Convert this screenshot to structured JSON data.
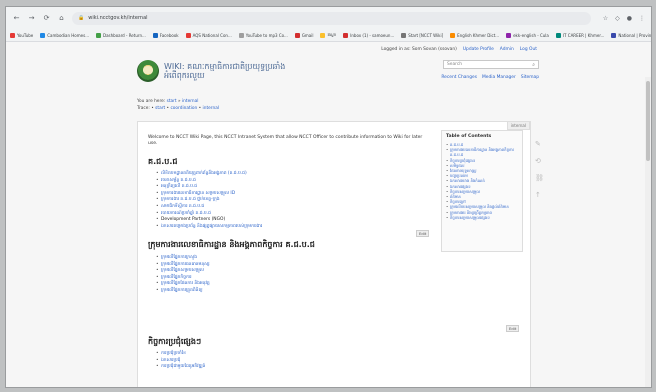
{
  "browser": {
    "nav": {
      "back": "←",
      "forward": "→",
      "reload": "⟳",
      "home": "⌂"
    },
    "url": "wiki.ncctgov.kh/internal",
    "icons": [
      "star-icon",
      "extensions-icon",
      "profile-icon",
      "menu-icon"
    ],
    "bookmarks": [
      {
        "label": "YouTube",
        "color": "#e53935"
      },
      {
        "label": "Cambodian Homes...",
        "color": "#1e88e5"
      },
      {
        "label": "Dashboard - Return...",
        "color": "#43a047"
      },
      {
        "label": "Facebook",
        "color": "#1565c0"
      },
      {
        "label": "AQS National Con...",
        "color": "#e53935"
      },
      {
        "label": "YouTube to mp3 Co...",
        "color": "#9e9e9e"
      },
      {
        "label": "Gmail",
        "color": "#d32f2f"
      },
      {
        "label": "ឥណ្ឌា",
        "color": "#fbc02d"
      },
      {
        "label": "Inbox (1) - samoeun...",
        "color": "#d32f2f"
      },
      {
        "label": "Start [NCCT Wiki]",
        "color": "#757575"
      },
      {
        "label": "English Khmer Dict...",
        "color": "#fb8c00"
      },
      {
        "label": "ekk-english - Cula",
        "color": "#8e24aa"
      },
      {
        "label": "IT CAREER | Khmer...",
        "color": "#00897b"
      },
      {
        "label": "National | Provin R...",
        "color": "#3949ab"
      }
    ]
  },
  "wiki": {
    "userbar": {
      "logged_in": "Logged in as: Som Sovan (ssovan)",
      "update_profile": "Update Profile",
      "admin": "Admin",
      "logout": "Log Out"
    },
    "title_line1": "WIKI: គណៈកម្មាធិការជាតិប្រយុទ្ធប្រឆាំង",
    "title_line2": "អំពើពុករលួយ",
    "search_placeholder": "Search",
    "tools": {
      "recent": "Recent Changes",
      "media": "Media Manager",
      "sitemap": "Sitemap"
    },
    "crumbs": {
      "you_are_here_label": "You are here:",
      "you_are_here_path1": "start",
      "you_are_here_path2": "internal",
      "trace_label": "Trace:",
      "trace_path1": "start",
      "trace_path2": "coordination",
      "trace_path3": "internal"
    },
    "page_tab": "internal",
    "intro": "Welcome to NCCT Wiki Page, this NCCT Intranet System that allow NCCT Officer to contribute information to Wiki for later use.",
    "section1": {
      "heading": "គ.ជ.ប.ជ",
      "items": [
        "លិខិតបទដ្ឋានគតិយុត្តពាក់ព័ន្ធនឹងអង្គភាព (គ.ជ.ប.ជ)",
        "រចនាសម្ព័ន្ធ គ.ជ.ប.ជ",
        "អនុក្រឹត្យលើ គ.ជ.ប.ជ",
        "ក្រុមការងារលេខាធិការដ្ឋាន សម្របសម្រួល ID",
        "ក្រុមការងារ គ.ជ.ប.ជ ថ្នាក់ខេត្ត-ក្រុង",
        "សមាជិកទីស្តីការ គ.ជ.ប.ជ",
        "របាយការណ៍ប្រចាំឆ្នាំ គ.ជ.ប.ជ",
        "Development Partners (NGO)",
        "ឯកសារគម្រោងប្រព័ន្ធ និងផ្សព្វផ្សាយសកម្មភាពរបស់ក្រុមការងារ"
      ],
      "edit": "Edit"
    },
    "section2": {
      "heading": "ក្រុមការងារលេខាធិការដ្ឋាន និងអង្គភាពកិច្ចការ គ.ជ.ប.ជ",
      "items": [
        "ក្រុមលើផ្នែកការក្រសួង",
        "ក្រុមលើផ្នែកការធនធានមនុស្ស",
        "ក្រុមលើផ្នែកសម្របសម្រួល",
        "ក្រុមលើផ្នែកកិច្ចការ",
        "ក្រុមលើផ្នែកផែនការ និងអនុវត្ត",
        "ក្រុមលើផ្នែកការត្រួតពិនិត្យ"
      ],
      "edit": "Edit"
    },
    "section3": {
      "heading": "កិច្ចការប្រជុំផ្សេងៗ",
      "items": [
        "ការប្រជុំប្រចាំខែ",
        "ឯកសារប្រជុំ",
        "ការប្រជុំជាមួយដៃគូអភិវឌ្ឍន៍"
      ],
      "edit": "Edit"
    },
    "toc": {
      "title": "Table of Contents",
      "items": [
        "គ.ជ.ប.ជ",
        "ក្រុមការងារលេខាធិការដ្ឋាន និងអង្គភាពកិច្ចការ គ.ជ.ប.ជ",
        "កិច្ចការប្រជុំផ្សេងៗ",
        "សមិទ្ធផល",
        "ផែនការយុទ្ធសាស្ត្រ",
        "បញ្ហាប្រឈម",
        "ឯកសារយោង និងកំណត់",
        "ឯកសារផ្សេងៗ",
        "កិច្ចការសម្របសម្រួល",
        "ព័ត៌មាន",
        "កិច្ចការក្រៅ",
        "ក្រុមលើការសម្របសម្រួល និងផ្តល់ព័ត៌មាន",
        "ក្រុមការងារ និងប្រព្រឹត្តកម្មភាព",
        "កិច្ចការសម្របសម្រួលផ្សេងៗ"
      ]
    }
  }
}
